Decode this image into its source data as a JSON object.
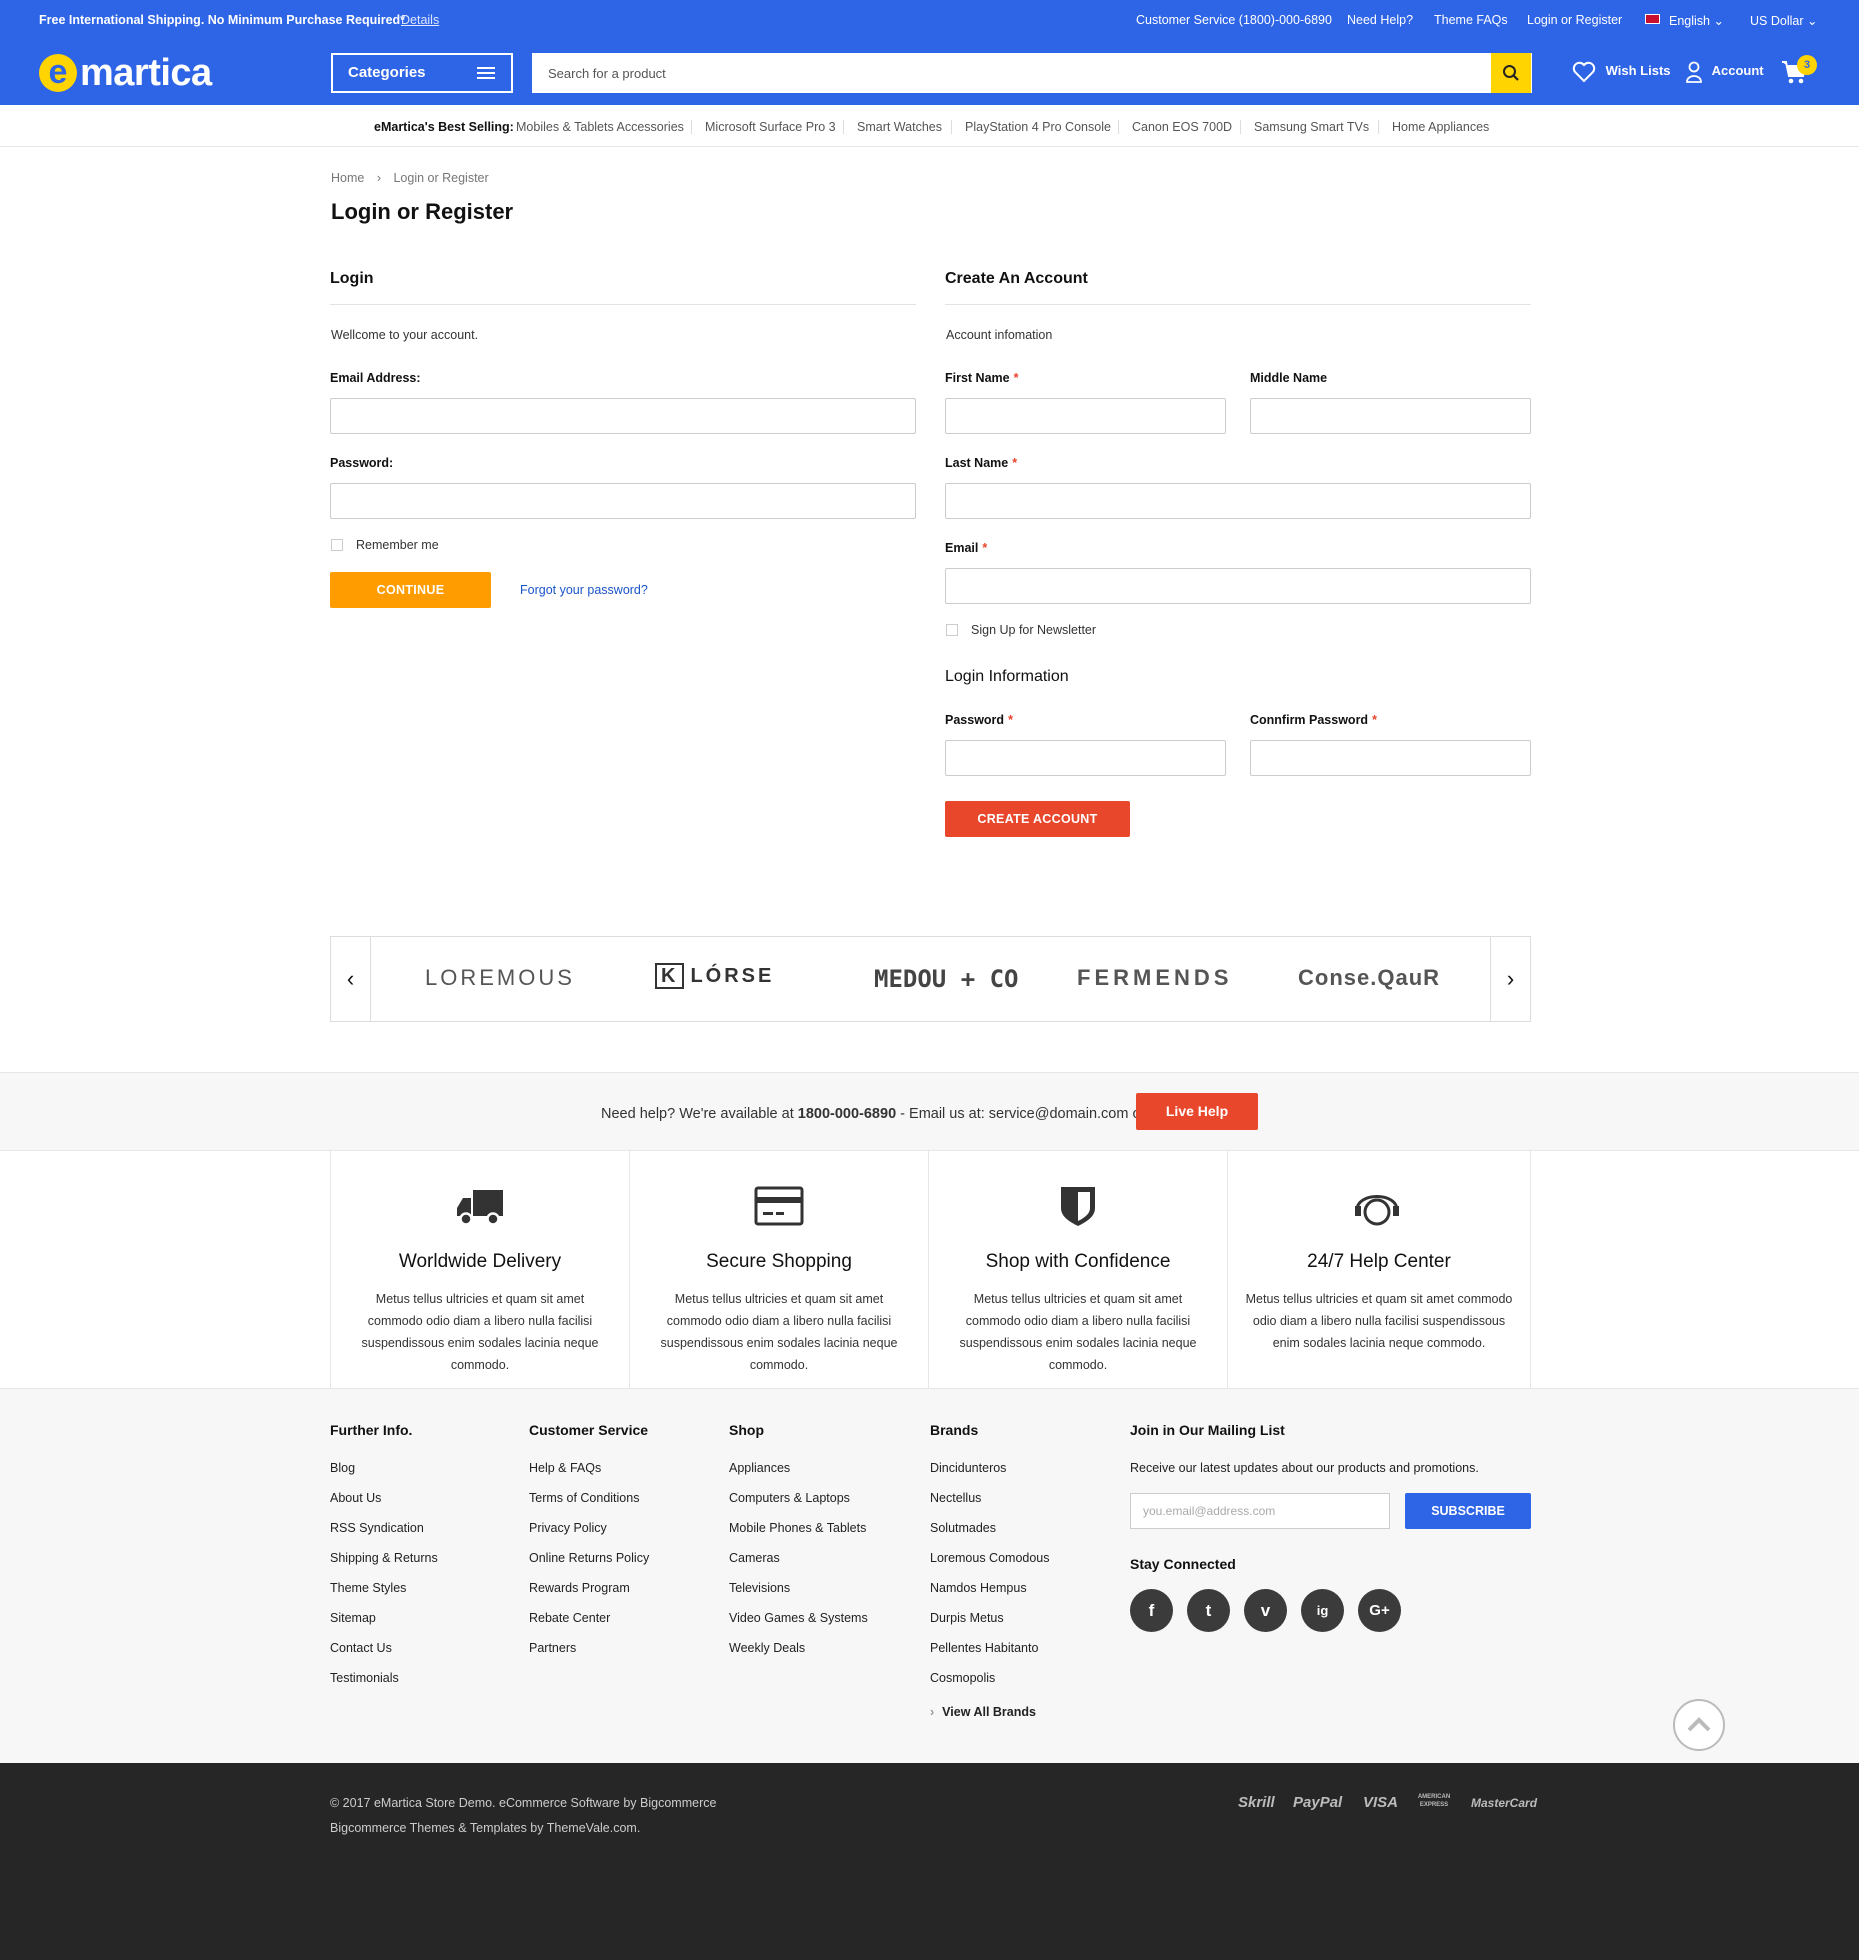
{
  "topbar": {
    "shipping": "Free International Shipping. No Minimum Purchase Required*",
    "details": "Details",
    "customer_service": "Customer Service (1800)-000-6890",
    "need_help": "Need Help?",
    "theme_faqs": "Theme FAQs",
    "login_register": "Login or Register",
    "language": "English",
    "currency": "US Dollar"
  },
  "header": {
    "logo_mark": "e",
    "logo_text": "martica",
    "categories": "Categories",
    "search_placeholder": "Search for a product",
    "wish_lists": "Wish Lists",
    "account": "Account",
    "cart_count": "3"
  },
  "best_selling": {
    "label": "eMartica's Best Selling:",
    "items": [
      "Mobiles & Tablets Accessories",
      "Microsoft Surface Pro 3",
      "Smart Watches",
      "PlayStation 4 Pro Console",
      "Canon EOS 700D",
      "Samsung Smart TVs",
      "Home Appliances"
    ]
  },
  "breadcrumb": {
    "home": "Home",
    "current": "Login or Register"
  },
  "page_title": "Login or Register",
  "login": {
    "heading": "Login",
    "welcome": "Wellcome to your account.",
    "email_label": "Email Address:",
    "password_label": "Password:",
    "remember": "Remember me",
    "continue": "CONTINUE",
    "forgot": "Forgot your password?"
  },
  "register": {
    "heading": "Create An Account",
    "info": "Account infomation",
    "first_name": "First Name",
    "middle_name": "Middle Name",
    "last_name": "Last Name",
    "email": "Email",
    "newsletter": "Sign Up for Newsletter",
    "login_info": "Login Information",
    "password": "Password",
    "confirm_password": "Connfirm Password",
    "required_mark": "*",
    "create": "CREATE ACCOUNT"
  },
  "brands": [
    "LOREMOUS",
    "LÓRSE",
    "MEDOU + CO",
    "FERMENDS",
    "Conse.QauR"
  ],
  "brand_k": "K",
  "help": {
    "prefix": "Need help? We're available at ",
    "phone": "1800-000-6890",
    "suffix": " - Email us at: service@domain.com or",
    "button": "Live Help"
  },
  "features": [
    {
      "title": "Worldwide Delivery",
      "desc": "Metus tellus ultricies et quam sit amet commodo odio diam a libero nulla facilisi suspendissous enim sodales lacinia neque commodo.",
      "icon": "truck-icon"
    },
    {
      "title": "Secure Shopping",
      "desc": "Metus tellus ultricies et quam sit amet commodo odio diam a libero nulla facilisi suspendissous enim sodales lacinia neque commodo.",
      "icon": "credit-card-icon"
    },
    {
      "title": "Shop with Confidence",
      "desc": "Metus tellus ultricies et quam sit amet commodo odio diam a libero nulla facilisi suspendissous enim sodales lacinia neque commodo.",
      "icon": "shield-icon"
    },
    {
      "title": "24/7 Help Center",
      "desc": "Metus tellus ultricies et quam sit amet commodo odio diam a libero nulla facilisi suspendissous enim sodales lacinia neque commodo.",
      "icon": "headset-icon"
    }
  ],
  "footer": {
    "further_info": {
      "heading": "Further Info.",
      "links": [
        "Blog",
        "About Us",
        "RSS Syndication",
        "Shipping & Returns",
        "Theme Styles",
        "Sitemap",
        "Contact Us",
        "Testimonials"
      ]
    },
    "customer_service": {
      "heading": "Customer Service",
      "links": [
        "Help & FAQs",
        "Terms of Conditions",
        "Privacy Policy",
        "Online Returns Policy",
        "Rewards Program",
        "Rebate Center",
        "Partners"
      ]
    },
    "shop": {
      "heading": "Shop",
      "links": [
        "Appliances",
        "Computers & Laptops",
        "Mobile Phones & Tablets",
        "Cameras",
        "Televisions",
        "Video Games & Systems",
        "Weekly Deals"
      ]
    },
    "brands": {
      "heading": "Brands",
      "links": [
        "Dincidunteros",
        "Nectellus",
        "Solutmades",
        "Loremous Comodous",
        "Namdos Hempus",
        "Durpis Metus",
        "Pellentes Habitanto",
        "Cosmopolis"
      ],
      "view_all": "View All Brands"
    },
    "mailing": {
      "heading": "Join in Our Mailing List",
      "text": "Receive our latest updates about our products and promotions.",
      "placeholder": "you.email@address.com",
      "button": "SUBSCRIBE",
      "stay": "Stay Connected"
    },
    "social": [
      "f",
      "t",
      "v",
      "ig",
      "G+"
    ]
  },
  "bottom": {
    "copyright": "© 2017 eMartica Store Demo. eCommerce Software by Bigcommerce",
    "themes": "Bigcommerce Themes & Templates by ThemeVale.com.",
    "payments": [
      "Skrill",
      "PayPal",
      "VISA",
      "AMERICAN EXPRESS",
      "MasterCard"
    ]
  },
  "colors": {
    "primary": "#2e64e6",
    "accent_yellow": "#ffd400",
    "continue": "#ff9c00",
    "create": "#e8472b",
    "dark": "#262626"
  }
}
